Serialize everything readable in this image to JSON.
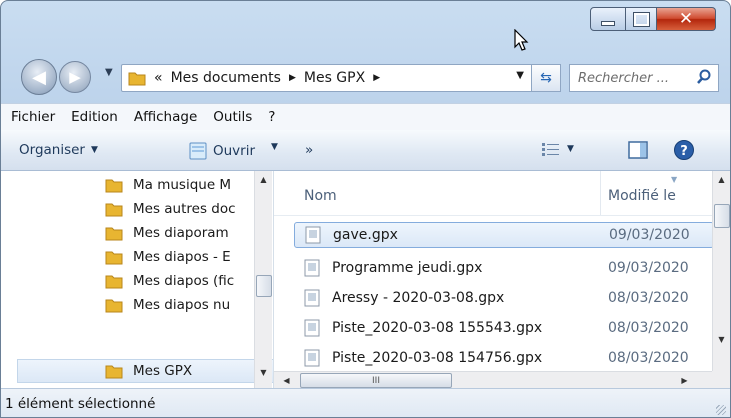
{
  "window": {
    "buttons": {
      "minimize": "minimize",
      "maximize": "maximize",
      "close": "close"
    }
  },
  "nav": {
    "history": "▼",
    "address": {
      "overflow": "«",
      "segments": [
        "Mes documents",
        "Mes GPX"
      ],
      "separator": "▶"
    },
    "search_placeholder": "Rechercher ..."
  },
  "menubar": [
    "Fichier",
    "Edition",
    "Affichage",
    "Outils",
    "?"
  ],
  "toolbar": {
    "organize": "Organiser",
    "open": "Ouvrir",
    "more": "»"
  },
  "sidebar": {
    "items": [
      {
        "label": "Ma musique M"
      },
      {
        "label": "Mes autres doc"
      },
      {
        "label": "Mes diaporam"
      },
      {
        "label": "Mes diapos - E"
      },
      {
        "label": "Mes diapos (fic"
      },
      {
        "label": "Mes diapos nu"
      },
      {
        "label": "Mes GPX",
        "selected": true
      }
    ]
  },
  "files": {
    "columns": [
      "Nom",
      "Modifié le"
    ],
    "rows": [
      {
        "name": "gave.gpx",
        "date": "09/03/2020",
        "selected": true
      },
      {
        "name": "Programme jeudi.gpx",
        "date": "09/03/2020"
      },
      {
        "name": "Aressy - 2020-03-08.gpx",
        "date": "08/03/2020"
      },
      {
        "name": "Piste_2020-03-08 155543.gpx",
        "date": "08/03/2020"
      },
      {
        "name": "Piste_2020-03-08 154756.gpx",
        "date": "08/03/2020"
      }
    ],
    "hscroll_label": "III"
  },
  "status": {
    "text": "1 élément sélectionné"
  },
  "colors": {
    "folder": "#e8b531",
    "selection": "#dbe8f7",
    "selection_border": "#84acdd",
    "close": "#c7371b"
  }
}
